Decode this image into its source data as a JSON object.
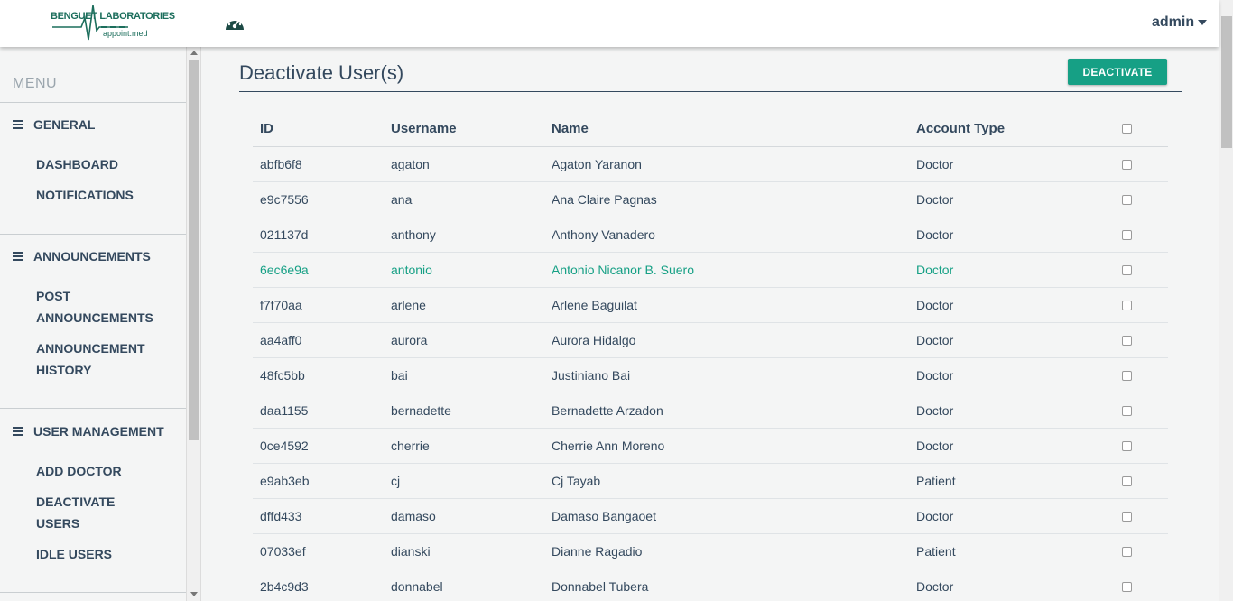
{
  "navbar": {
    "logo_line1": "BENGUET LABORATORIES",
    "logo_line2": "appoint.med",
    "dashboard_icon": "speedometer-icon",
    "user_label": "admin"
  },
  "sidebar": {
    "menu_title": "MENU",
    "sections": [
      {
        "label": "GENERAL",
        "items": [
          "DASHBOARD",
          "NOTIFICATIONS"
        ]
      },
      {
        "label": "ANNOUNCEMENTS",
        "items": [
          "POST ANNOUNCEMENTS",
          "ANNOUNCEMENT HISTORY"
        ]
      },
      {
        "label": "USER MANAGEMENT",
        "items": [
          "ADD DOCTOR",
          "DEACTIVATE USERS",
          "IDLE USERS"
        ]
      }
    ]
  },
  "main": {
    "title": "Deactivate User(s)",
    "deactivate_button": "DEACTIVATE",
    "columns": [
      "ID",
      "Username",
      "Name",
      "Account Type"
    ],
    "rows": [
      {
        "id": "abfb6f8",
        "username": "agaton",
        "name": "Agaton Yaranon",
        "type": "Doctor"
      },
      {
        "id": "e9c7556",
        "username": "ana",
        "name": "Ana Claire Pagnas",
        "type": "Doctor"
      },
      {
        "id": "021137d",
        "username": "anthony",
        "name": "Anthony Vanadero",
        "type": "Doctor"
      },
      {
        "id": "6ec6e9a",
        "username": "antonio",
        "name": "Antonio Nicanor B. Suero",
        "type": "Doctor"
      },
      {
        "id": "f7f70aa",
        "username": "arlene",
        "name": "Arlene Baguilat",
        "type": "Doctor"
      },
      {
        "id": "aa4aff0",
        "username": "aurora",
        "name": "Aurora Hidalgo",
        "type": "Doctor"
      },
      {
        "id": "48fc5bb",
        "username": "bai",
        "name": "Justiniano Bai",
        "type": "Doctor"
      },
      {
        "id": "daa1155",
        "username": "bernadette",
        "name": "Bernadette Arzadon",
        "type": "Doctor"
      },
      {
        "id": "0ce4592",
        "username": "cherrie",
        "name": "Cherrie Ann Moreno",
        "type": "Doctor"
      },
      {
        "id": "e9ab3eb",
        "username": "cj",
        "name": "Cj Tayab",
        "type": "Patient"
      },
      {
        "id": "dffd433",
        "username": "damaso",
        "name": "Damaso Bangaoet",
        "type": "Doctor"
      },
      {
        "id": "07033ef",
        "username": "dianski",
        "name": "Dianne Ragadio",
        "type": "Patient"
      },
      {
        "id": "2b4c9d3",
        "username": "donnabel",
        "name": "Donnabel Tubera",
        "type": "Doctor"
      }
    ],
    "highlighted_row": 3
  },
  "colors": {
    "accent": "#16a085",
    "text": "#34495e",
    "background": "#f4f5f5"
  }
}
